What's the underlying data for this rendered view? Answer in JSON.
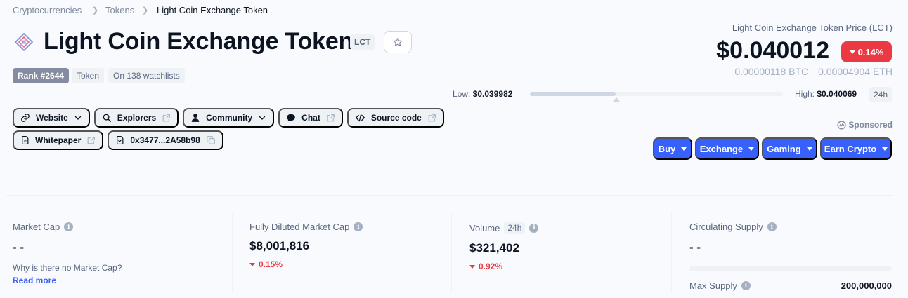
{
  "breadcrumb": {
    "items": [
      "Cryptocurrencies",
      "Tokens",
      "Light Coin Exchange Token"
    ]
  },
  "coin": {
    "name": "Light Coin Exchange Token",
    "symbol": "LCT",
    "rank": "Rank #2644",
    "type": "Token",
    "watchlists": "On 138 watchlists"
  },
  "links": {
    "website": "Website",
    "explorers": "Explorers",
    "community": "Community",
    "chat": "Chat",
    "source_code": "Source code",
    "whitepaper": "Whitepaper",
    "contract": "0x3477...2A58b98"
  },
  "price": {
    "label": "Light Coin Exchange Token Price (LCT)",
    "value": "$0.040012",
    "change": "0.14%",
    "btc": "0.00000118 BTC",
    "eth": "0.00004904 ETH",
    "low_label": "Low:",
    "low": "$0.039982",
    "high_label": "High:",
    "high": "$0.040069",
    "period": "24h",
    "range_position": 0.34
  },
  "sponsored": "Sponsored",
  "actions": [
    "Buy",
    "Exchange",
    "Gaming",
    "Earn Crypto"
  ],
  "stats": {
    "market_cap": {
      "label": "Market Cap",
      "value": "- -",
      "question": "Why is there no Market Cap?",
      "link": "Read more"
    },
    "fdmc": {
      "label": "Fully Diluted Market Cap",
      "value": "$8,001,816",
      "change": "0.15%"
    },
    "volume": {
      "label": "Volume",
      "period": "24h",
      "value": "$321,402",
      "change": "0.92%"
    },
    "circulating": {
      "label": "Circulating Supply",
      "value": "- -",
      "max_label": "Max Supply",
      "max_value": "200,000,000"
    }
  },
  "colors": {
    "accent": "#3861fb",
    "negative": "#ea3943",
    "text": "#0d1421",
    "muted": "#58667e"
  }
}
